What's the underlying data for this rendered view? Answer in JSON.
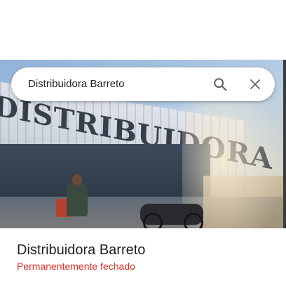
{
  "search": {
    "query": "Distribuidora Barreto"
  },
  "photo": {
    "sign_text": "DISTRIBUIDORA BARRETO E SILVA"
  },
  "place": {
    "name": "Distribuidora Barreto",
    "status": "Permanentemente fechado",
    "status_color": "#d93025"
  },
  "icons": {
    "search": "search-icon",
    "close": "close-icon"
  }
}
